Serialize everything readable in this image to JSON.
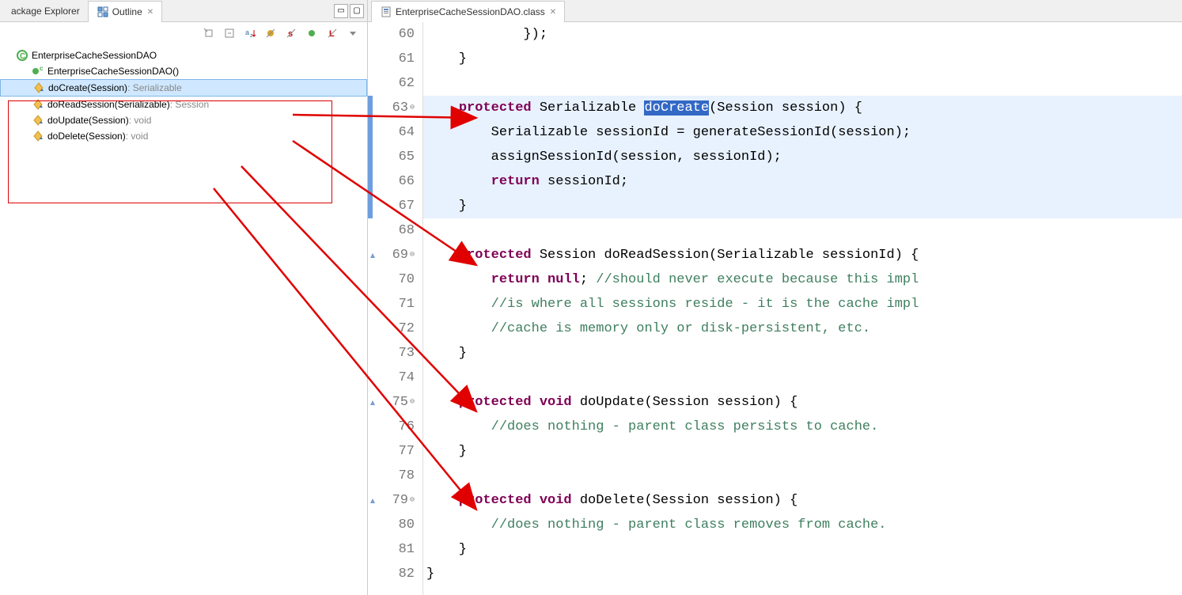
{
  "leftPanel": {
    "tabs": {
      "packageExplorer": "ackage Explorer",
      "outline": "Outline"
    },
    "tree": {
      "root": "EnterpriseCacheSessionDAO",
      "constructor": "EnterpriseCacheSessionDAO()",
      "methods": [
        {
          "name": "doCreate(Session)",
          "return": " : Serializable"
        },
        {
          "name": "doReadSession(Serializable)",
          "return": " : Session"
        },
        {
          "name": "doUpdate(Session)",
          "return": " : void"
        },
        {
          "name": "doDelete(Session)",
          "return": " : void"
        }
      ]
    }
  },
  "editor": {
    "tabLabel": "EnterpriseCacheSessionDAO.class",
    "lines": [
      {
        "num": "60",
        "pre": "            });",
        "kw": "",
        "post": ""
      },
      {
        "num": "61",
        "pre": "    }",
        "kw": "",
        "post": ""
      },
      {
        "num": "62",
        "pre": "",
        "kw": "",
        "post": ""
      },
      {
        "num": "63",
        "pre": "    ",
        "kw": "protected",
        "post": " Serializable ",
        "sel": "doCreate",
        "post2": "(Session session) {"
      },
      {
        "num": "64",
        "pre": "        Serializable sessionId = generateSessionId(session);",
        "kw": "",
        "post": ""
      },
      {
        "num": "65",
        "pre": "        assignSessionId(session, sessionId);",
        "kw": "",
        "post": ""
      },
      {
        "num": "66",
        "pre": "        ",
        "kw": "return",
        "post": " sessionId;"
      },
      {
        "num": "67",
        "pre": "    }",
        "kw": "",
        "post": ""
      },
      {
        "num": "68",
        "pre": "",
        "kw": "",
        "post": ""
      },
      {
        "num": "69",
        "pre": "    ",
        "kw": "protected",
        "post": " Session doReadSession(Serializable sessionId) {"
      },
      {
        "num": "70",
        "pre": "        ",
        "kw": "return null",
        "post": "; ",
        "cm": "//should never execute because this impl"
      },
      {
        "num": "71",
        "pre": "        ",
        "kw": "",
        "post": "",
        "cm": "//is where all sessions reside - it is the cache impl"
      },
      {
        "num": "72",
        "pre": "        ",
        "kw": "",
        "post": "",
        "cm": "//cache is memory only or disk-persistent, etc."
      },
      {
        "num": "73",
        "pre": "    }",
        "kw": "",
        "post": ""
      },
      {
        "num": "74",
        "pre": "",
        "kw": "",
        "post": ""
      },
      {
        "num": "75",
        "pre": "    ",
        "kw": "protected void",
        "post": " doUpdate(Session session) {"
      },
      {
        "num": "76",
        "pre": "        ",
        "kw": "",
        "post": "",
        "cm": "//does nothing - parent class persists to cache."
      },
      {
        "num": "77",
        "pre": "    }",
        "kw": "",
        "post": ""
      },
      {
        "num": "78",
        "pre": "",
        "kw": "",
        "post": ""
      },
      {
        "num": "79",
        "pre": "    ",
        "kw": "protected void",
        "post": " doDelete(Session session) {"
      },
      {
        "num": "80",
        "pre": "        ",
        "kw": "",
        "post": "",
        "cm": "//does nothing - parent class removes from cache."
      },
      {
        "num": "81",
        "pre": "    }",
        "kw": "",
        "post": ""
      },
      {
        "num": "82",
        "pre": "}",
        "kw": "",
        "post": ""
      }
    ]
  }
}
